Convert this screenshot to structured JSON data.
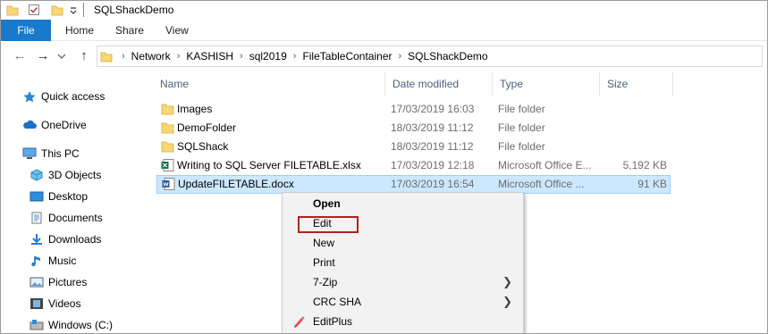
{
  "window": {
    "title": "SQLShackDemo"
  },
  "ribbon": {
    "tabs": [
      "File",
      "Home",
      "Share",
      "View"
    ]
  },
  "address_bar": {
    "breadcrumbs": [
      "Network",
      "KASHISH",
      "sql2019",
      "FileTableContainer",
      "SQLShackDemo"
    ]
  },
  "sidebar": {
    "items": [
      {
        "label": "Quick access",
        "icon": "star-icon"
      },
      {
        "label": "OneDrive",
        "icon": "cloud-icon"
      },
      {
        "label": "This PC",
        "icon": "computer-icon"
      },
      {
        "label": "3D Objects",
        "icon": "cube-icon"
      },
      {
        "label": "Desktop",
        "icon": "desktop-icon"
      },
      {
        "label": "Documents",
        "icon": "documents-icon"
      },
      {
        "label": "Downloads",
        "icon": "download-icon"
      },
      {
        "label": "Music",
        "icon": "music-icon"
      },
      {
        "label": "Pictures",
        "icon": "pictures-icon"
      },
      {
        "label": "Videos",
        "icon": "videos-icon"
      },
      {
        "label": "Windows (C:)",
        "icon": "drive-icon"
      }
    ]
  },
  "file_list": {
    "columns": [
      "Name",
      "Date modified",
      "Type",
      "Size"
    ],
    "rows": [
      {
        "name": "Images",
        "date": "17/03/2019 16:03",
        "type": "File folder",
        "size": "",
        "icon": "folder-icon"
      },
      {
        "name": "DemoFolder",
        "date": "18/03/2019 11:12",
        "type": "File folder",
        "size": "",
        "icon": "folder-icon"
      },
      {
        "name": "SQLShack",
        "date": "18/03/2019 11:12",
        "type": "File folder",
        "size": "",
        "icon": "folder-icon"
      },
      {
        "name": "Writing to SQL Server FILETABLE.xlsx",
        "date": "17/03/2019 12:18",
        "type": "Microsoft Office E...",
        "size": "5,192 KB",
        "icon": "excel-file-icon"
      },
      {
        "name": "UpdateFILETABLE.docx",
        "date": "17/03/2019 16:54",
        "type": "Microsoft Office ...",
        "size": "91 KB",
        "icon": "word-file-icon",
        "selected": true
      }
    ]
  },
  "context_menu": {
    "items": [
      {
        "label": "Open",
        "bold": true
      },
      {
        "label": "Edit",
        "highlighted": true
      },
      {
        "label": "New"
      },
      {
        "label": "Print"
      },
      {
        "label": "7-Zip",
        "submenu": true
      },
      {
        "label": "CRC SHA",
        "submenu": true
      },
      {
        "label": "EditPlus",
        "icon": "editplus-icon"
      }
    ]
  },
  "colors": {
    "file_tab": "#1979ca",
    "selection": "#cce8ff",
    "selection_border": "#99d1ff",
    "highlight_box": "#b51f24",
    "folder": "#f8d775"
  }
}
